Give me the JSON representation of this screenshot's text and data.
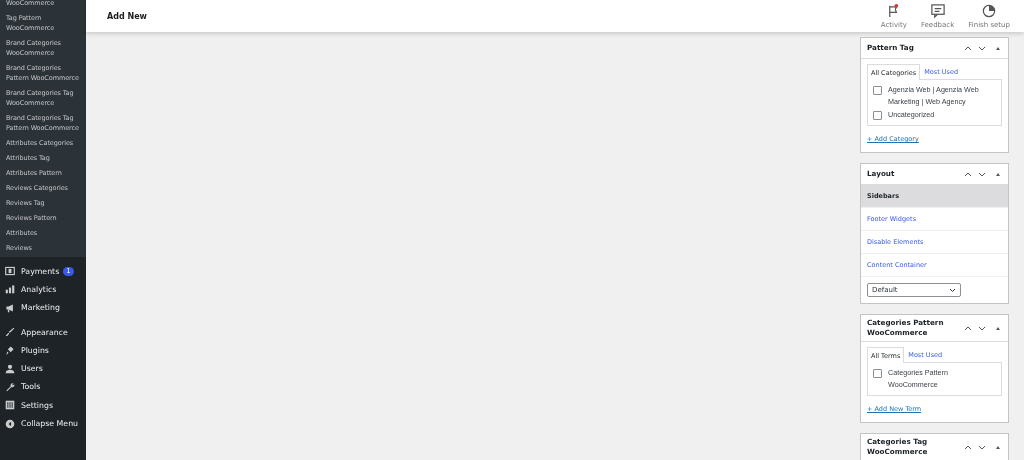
{
  "sidebar": {
    "submenu": [
      {
        "label": "WooCommerce"
      },
      {
        "label": "Tag Pattern WooCommerce"
      },
      {
        "label": "Brand Categories WooCommerce"
      },
      {
        "label": "Brand Categories Pattern WooCommerce"
      },
      {
        "label": "Brand Categories Tag WooCommerce"
      },
      {
        "label": "Brand Categories Tag Pattern WooCommerce"
      },
      {
        "label": "Attributes Categories"
      },
      {
        "label": "Attributes Tag"
      },
      {
        "label": "Attributes Pattern"
      },
      {
        "label": "Reviews Categories"
      },
      {
        "label": "Reviews Tag"
      },
      {
        "label": "Reviews Pattern"
      },
      {
        "label": "Attributes"
      },
      {
        "label": "Reviews"
      }
    ],
    "menu": [
      {
        "label": "Payments",
        "badge": "1"
      },
      {
        "label": "Analytics"
      },
      {
        "label": "Marketing"
      },
      {
        "label": "Appearance"
      },
      {
        "label": "Plugins"
      },
      {
        "label": "Users"
      },
      {
        "label": "Tools"
      },
      {
        "label": "Settings"
      },
      {
        "label": "Collapse Menu"
      }
    ]
  },
  "topbar": {
    "title": "Add New",
    "actions": [
      {
        "label": "Activity"
      },
      {
        "label": "Feedback"
      },
      {
        "label": "Finish setup"
      }
    ]
  },
  "panels": [
    {
      "kind": "taxonomy",
      "title": "Pattern Tag",
      "tabs": [
        {
          "label": "All Categories",
          "selected": true
        },
        {
          "label": "Most Used",
          "selected": false
        }
      ],
      "items": [
        {
          "label": "Agenzia Web | Agenzia Web Marketing | Web Agency",
          "checked": false
        },
        {
          "label": "Uncategorized",
          "checked": false
        }
      ],
      "add_link": "+ Add Category"
    },
    {
      "kind": "layout",
      "title": "Layout",
      "nav": [
        {
          "label": "Sidebars",
          "selected": true
        },
        {
          "label": "Footer Widgets",
          "selected": false
        },
        {
          "label": "Disable Elements",
          "selected": false
        },
        {
          "label": "Content Container",
          "selected": false
        }
      ],
      "select": "Default"
    },
    {
      "kind": "taxonomy",
      "title": "Categories Pattern WooCommerce",
      "tabs": [
        {
          "label": "All Terms",
          "selected": true
        },
        {
          "label": "Most Used",
          "selected": false
        }
      ],
      "items": [
        {
          "label": "Categories Pattern WooCommerce",
          "checked": false
        }
      ],
      "add_link": "+ Add New Term"
    },
    {
      "kind": "header",
      "title": "Categories Tag WooCommerce"
    }
  ]
}
